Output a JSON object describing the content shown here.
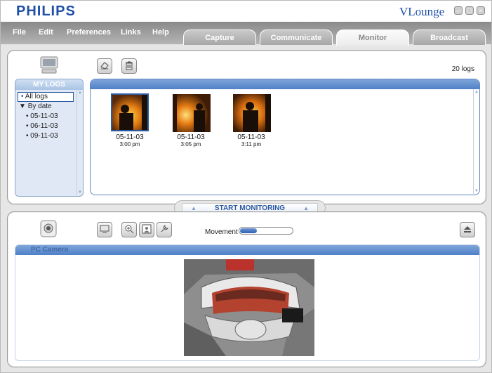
{
  "window": {
    "brand": "PHILIPS",
    "title": "VLounge"
  },
  "menu": {
    "items": [
      "File",
      "Edit",
      "Preferences",
      "Links",
      "Help"
    ]
  },
  "tabs": [
    {
      "label": "Capture",
      "active": false
    },
    {
      "label": "Communicate",
      "active": false
    },
    {
      "label": "Monitor",
      "active": true
    },
    {
      "label": "Broadcast",
      "active": false
    }
  ],
  "logs": {
    "count_label": "20 logs",
    "panel_title": "MY LOGS",
    "tree": {
      "all_logs": "All logs",
      "by_date": "By date",
      "dates": [
        "05-11-03",
        "06-11-03",
        "09-11-03"
      ]
    },
    "thumbnails": [
      {
        "date": "05-11-03",
        "time": "3:00 pm",
        "selected": true
      },
      {
        "date": "05-11-03",
        "time": "3:05 pm",
        "selected": false
      },
      {
        "date": "05-11-03",
        "time": "3:11 pm",
        "selected": false
      }
    ]
  },
  "monitor": {
    "start_label": "START MONITORING",
    "movement_label": "Movement",
    "movement_level": 0.32,
    "camera_title": "PC Camera"
  },
  "colors": {
    "brand_blue": "#1f4fa8",
    "header_blue": "#4f7fc7",
    "menu_grey": "#9b9b9b"
  },
  "icons": {
    "computer": "monitor-computer-icon",
    "eraser": "eraser-icon",
    "trash": "trash-icon",
    "webcam": "webcam-icon",
    "display": "display-icon",
    "zoom": "zoom-in-icon",
    "snapshot": "snapshot-icon",
    "settings": "wrench-icon",
    "eject": "eject-icon"
  }
}
